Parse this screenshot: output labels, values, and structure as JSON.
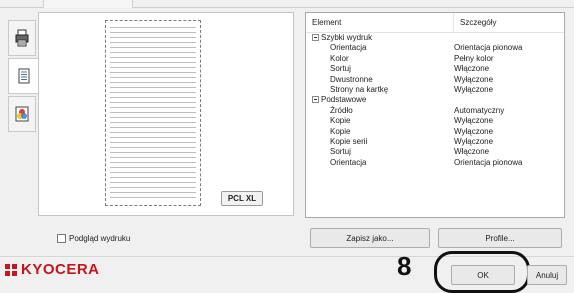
{
  "sidebar": {
    "tabs": [
      {
        "icon": "printer-icon"
      },
      {
        "icon": "document-list-icon"
      },
      {
        "icon": "color-icon"
      }
    ]
  },
  "preview": {
    "badge": "PCL XL",
    "checkbox_label": "Podgląd wydruku",
    "checked": false
  },
  "details": {
    "headers": {
      "element": "Element",
      "details": "Szczegóły"
    },
    "rows": [
      {
        "element": "Szybki wydruk",
        "value": "",
        "group": true
      },
      {
        "element": "Orientacja",
        "value": "Orientacja pionowa"
      },
      {
        "element": "Kolor",
        "value": "Pełny kolor"
      },
      {
        "element": "Sortuj",
        "value": "Włączone"
      },
      {
        "element": "Dwustronne",
        "value": "Wyłączone"
      },
      {
        "element": "Strony na kartkę",
        "value": "Wyłączone"
      },
      {
        "element": "Podstawowe",
        "value": "",
        "group": true
      },
      {
        "element": "Źródło",
        "value": "Automatyczny"
      },
      {
        "element": "Kopie",
        "value": "Wyłączone"
      },
      {
        "element": "Kopie",
        "value": "Wyłączone"
      },
      {
        "element": "Kopie serii",
        "value": "Wyłączone"
      },
      {
        "element": "Sortuj",
        "value": "Włączone"
      },
      {
        "element": "Orientacja",
        "value": "Orientacja pionowa"
      }
    ]
  },
  "buttons": {
    "save_as": "Zapisz jako...",
    "profiles": "Profile...",
    "ok": "OK",
    "cancel": "Anuluj"
  },
  "brand": {
    "name": "KYOCERA",
    "color": "#c4161c"
  },
  "annotation": {
    "step": "8"
  }
}
